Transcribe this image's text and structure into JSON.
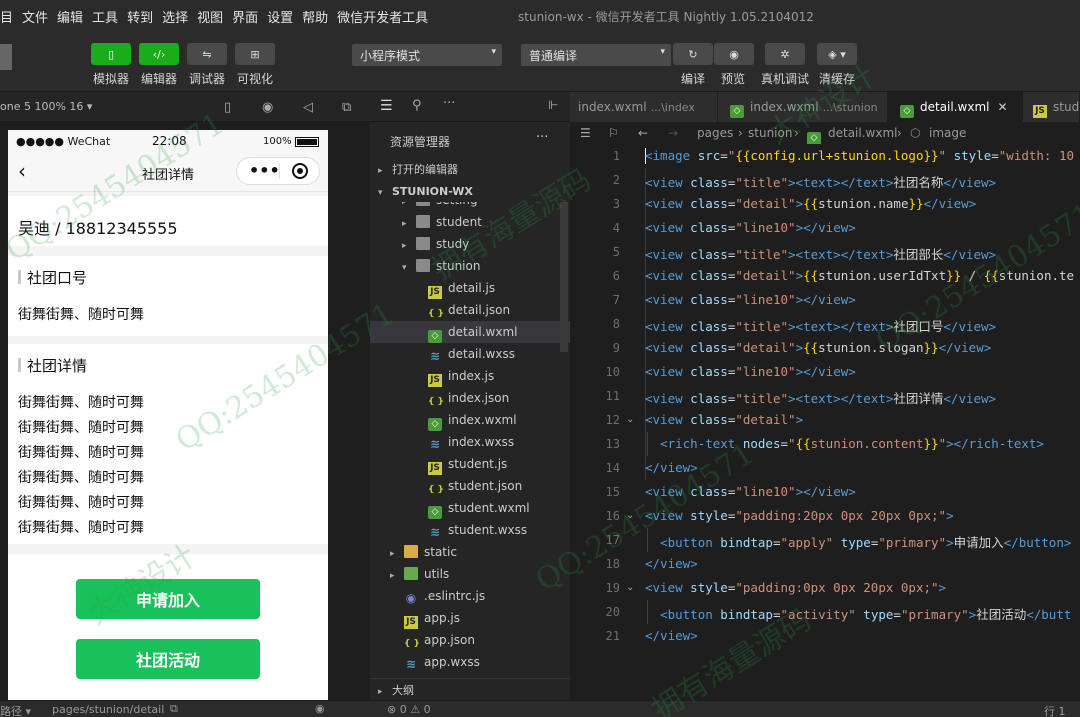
{
  "menubar": {
    "items": [
      "目",
      "文件",
      "编辑",
      "工具",
      "转到",
      "选择",
      "视图",
      "界面",
      "设置",
      "帮助",
      "微信开发者工具"
    ],
    "window_title": "stunion-wx - 微信开发者工具 Nightly 1.05.2104012"
  },
  "toolbar": {
    "left_buttons": [
      {
        "label": "模拟器",
        "icon": "phone-icon"
      },
      {
        "label": "编辑器",
        "icon": "code-icon"
      },
      {
        "label": "调试器",
        "icon": "debug-icon"
      },
      {
        "label": "可视化",
        "icon": "layout-icon"
      }
    ],
    "mode_select": "小程序模式",
    "compile_select": "普通编译",
    "right_buttons": [
      {
        "label": "编译",
        "icon": "refresh-icon"
      },
      {
        "label": "预览",
        "icon": "eye-icon"
      },
      {
        "label": "真机调试",
        "icon": "bug-icon"
      },
      {
        "label": "清缓存",
        "icon": "layers-icon"
      }
    ]
  },
  "simulator": {
    "device_label": "one 5 100% 16 ▾",
    "status": {
      "carrier": "●●●●● WeChat",
      "time": "22:08",
      "battery": "100%"
    },
    "nav_title": "社团详情",
    "user_line": "吴迪 / 18812345555",
    "slogan_title": "社团口号",
    "slogan": "街舞街舞、随时可舞",
    "detail_title": "社团详情",
    "detail_lines": [
      "街舞街舞、随时可舞",
      "街舞街舞、随时可舞",
      "街舞街舞、随时可舞",
      "街舞街舞、随时可舞",
      "街舞街舞、随时可舞",
      "街舞街舞、随时可舞"
    ],
    "apply_button": "申请加入",
    "activity_button": "社团活动"
  },
  "statusbar": {
    "path_label": "路径 ▾",
    "page_path": "pages/stunion/detail",
    "problems": "⊗ 0 ⚠ 0",
    "cursor": "行 1"
  },
  "explorer": {
    "title": "资源管理器",
    "open_editors": "打开的编辑器",
    "project": "STUNION-WX",
    "outline": "大纲",
    "rows": [
      {
        "label": "setting",
        "type": "folder",
        "indent": 2,
        "chevron": "▸"
      },
      {
        "label": "student",
        "type": "folder",
        "indent": 2,
        "chevron": "▸"
      },
      {
        "label": "study",
        "type": "folder",
        "indent": 2,
        "chevron": "▸"
      },
      {
        "label": "stunion",
        "type": "folder",
        "indent": 2,
        "chevron": "▾"
      },
      {
        "label": "detail.js",
        "type": "js",
        "indent": 3
      },
      {
        "label": "detail.json",
        "type": "json",
        "indent": 3
      },
      {
        "label": "detail.wxml",
        "type": "wxml",
        "indent": 3,
        "selected": true
      },
      {
        "label": "detail.wxss",
        "type": "wxss",
        "indent": 3
      },
      {
        "label": "index.js",
        "type": "js",
        "indent": 3
      },
      {
        "label": "index.json",
        "type": "json",
        "indent": 3
      },
      {
        "label": "index.wxml",
        "type": "wxml",
        "indent": 3
      },
      {
        "label": "index.wxss",
        "type": "wxss",
        "indent": 3
      },
      {
        "label": "student.js",
        "type": "js",
        "indent": 3
      },
      {
        "label": "student.json",
        "type": "json",
        "indent": 3
      },
      {
        "label": "student.wxml",
        "type": "wxml",
        "indent": 3
      },
      {
        "label": "student.wxss",
        "type": "wxss",
        "indent": 3
      },
      {
        "label": "static",
        "type": "folder-yellow",
        "indent": 1,
        "chevron": "▸"
      },
      {
        "label": "utils",
        "type": "folder-green",
        "indent": 1,
        "chevron": "▸"
      },
      {
        "label": ".eslintrc.js",
        "type": "eslint",
        "indent": 1
      },
      {
        "label": "app.js",
        "type": "js",
        "indent": 1
      },
      {
        "label": "app.json",
        "type": "json",
        "indent": 1
      },
      {
        "label": "app.wxss",
        "type": "wxss",
        "indent": 1
      }
    ]
  },
  "tabs": [
    {
      "name": "index.wxml",
      "path": "...\\index",
      "icon": "none",
      "active": false
    },
    {
      "name": "index.wxml",
      "path": "...\\stunion",
      "icon": "wxml",
      "active": false
    },
    {
      "name": "detail.wxml",
      "path": "",
      "icon": "wxml",
      "active": true
    },
    {
      "name": "stud",
      "path": "",
      "icon": "js",
      "active": false
    }
  ],
  "breadcrumb": [
    "pages",
    "stunion",
    "detail.wxml",
    "image"
  ],
  "code": {
    "line_numbers": [
      "1",
      "2",
      "3",
      "4",
      "5",
      "6",
      "7",
      "8",
      "9",
      "10",
      "11",
      "12",
      "13",
      "14",
      "15",
      "16",
      "17",
      "18",
      "19",
      "20",
      "21"
    ],
    "folds": [
      12,
      16,
      19
    ]
  },
  "watermarks": [
    "QQ:2545404571",
    "大神设计",
    "拥有海量源码"
  ]
}
